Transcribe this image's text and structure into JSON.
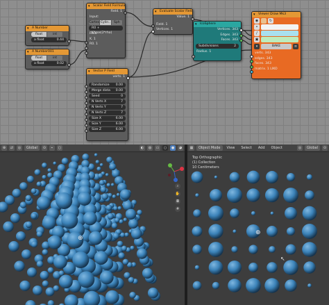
{
  "nodes": {
    "number_a": {
      "title": "A Number",
      "mode_float": "float",
      "mode_int": "int",
      "field_label": "a float",
      "field_value": "0.44"
    },
    "number_b": {
      "title": "A Number001",
      "mode_float": "float",
      "mode_int": "int",
      "field_label": "a float",
      "field_value": "0.02"
    },
    "formula": {
      "title": "Scalar Field Formula",
      "out_field": "Field. 1",
      "input_label": "Input:",
      "modes": [
        "Cartes",
        "Cylin..",
        "Sph"
      ],
      "formula": "R0 + K*cos(2*rho)",
      "field": "Field",
      "k": "K. 1",
      "r0": "R0. 1"
    },
    "evaluate": {
      "title": "Evaluate Scalar Field",
      "value": "Value. 1",
      "field": "Field. 1",
      "vertices": "Vertices. 1"
    },
    "vector_p": {
      "title": "Vector P Field",
      "out": "verts. 1",
      "rows": [
        {
          "label": "Randomize",
          "value": "0.00"
        },
        {
          "label": "Merge dista",
          "value": "0.00"
        },
        {
          "label": "Seed",
          "value": "0"
        },
        {
          "label": "N Verts X",
          "value": "7"
        },
        {
          "label": "N Verts Y",
          "value": "7"
        },
        {
          "label": "N Verts Z",
          "value": "7"
        },
        {
          "label": "Size X",
          "value": "6.00"
        },
        {
          "label": "Size Y",
          "value": "6.00"
        },
        {
          "label": "Size Z",
          "value": "6.00"
        }
      ]
    },
    "icosphere": {
      "title": "IcoSphere",
      "outputs": [
        "Vertices. 343",
        "Edges. 343",
        "Faces. 343"
      ],
      "subdiv_label": "Subdivisions",
      "subdiv_value": "2",
      "radius": "Radius. 1"
    },
    "viewer": {
      "title": "Viewer Draw Mk3",
      "bake": "BAKE",
      "inputs": [
        "verts. 343",
        "edges. 343",
        "faces. 343",
        "matrix. 1 LIKO"
      ]
    }
  },
  "viewport_left": {
    "view_label": "Global"
  },
  "viewport_right": {
    "mode": "Object Mode",
    "menus": [
      "View",
      "Select",
      "Add",
      "Object"
    ],
    "orient": "Global",
    "info": [
      "Top Orthographic",
      "(1) Collection",
      "10 Centimeters"
    ]
  },
  "colors": {
    "header_orange": "#e49835",
    "header_cyan": "#2aa7a1",
    "viewer_body": "#e86a23",
    "sphere_blue": "#3b82b8"
  }
}
